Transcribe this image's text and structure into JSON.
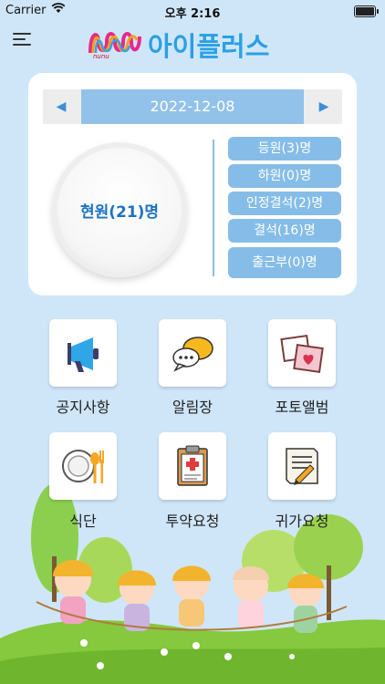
{
  "status_bar": {
    "carrier": "Carrier",
    "time": "오후 2:16"
  },
  "header": {
    "app_name": "아이플러스",
    "logo_small": "nunu"
  },
  "date_nav": {
    "date": "2022-12-08"
  },
  "summary": {
    "current": "현원(21)명",
    "stats": [
      "등원(3)명",
      "하원(0)명",
      "인정결석(2)명",
      "결석(16)명",
      "출근부(0)명"
    ]
  },
  "menu_tiles": [
    {
      "label": "공지사항",
      "icon": "megaphone-icon"
    },
    {
      "label": "알림장",
      "icon": "speech-bubble-icon"
    },
    {
      "label": "포토앨범",
      "icon": "photo-album-icon"
    },
    {
      "label": "식단",
      "icon": "meal-plate-icon"
    },
    {
      "label": "투약요청",
      "icon": "medicine-clipboard-icon"
    },
    {
      "label": "귀가요청",
      "icon": "document-pen-icon"
    }
  ],
  "colors": {
    "background": "#cfe6f8",
    "accent": "#2aa0e6",
    "pill": "#86bde8",
    "date_bar": "#92c2ea"
  }
}
